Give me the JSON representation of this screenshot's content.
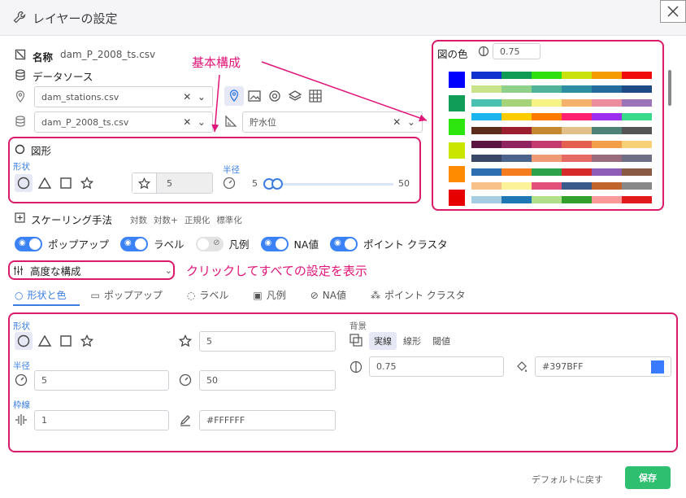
{
  "dialog": {
    "title": "レイヤーの設定"
  },
  "name": {
    "label": "名称",
    "value": "dam_P_2008_ts.csv"
  },
  "datasource": {
    "label": "データソース",
    "select1": "dam_stations.csv",
    "select2": "dam_P_2008_ts.csv",
    "select3": "貯水位"
  },
  "annotations": {
    "basic": "基本構成",
    "advanced": "クリックしてすべての設定を表示"
  },
  "shape": {
    "title": "図形",
    "shape_label": "形状",
    "radius_label": "半径",
    "size_value": "5",
    "slider_min": "5",
    "slider_max": "50"
  },
  "color": {
    "title": "図の色",
    "opacity": "0.75",
    "swatches": [
      "#0000ff",
      "#0f9d58",
      "#2ee60f",
      "#c8e600",
      "#ff8c00",
      "#e60000"
    ],
    "palettes": [
      [
        "#1033cf",
        "#119c55",
        "#2fe00f",
        "#c9e10c",
        "#f59c00",
        "#f00c0c"
      ],
      [
        "#c9e38a",
        "#8fd08b",
        "#4fb39a",
        "#2e8fa3",
        "#236c9c",
        "#1e4a85"
      ],
      [
        "#4ac0b0",
        "#a6d379",
        "#f7f286",
        "#f4b26a",
        "#ec8d9f",
        "#9b73b9"
      ],
      [
        "#1bb4ef",
        "#ffcc00",
        "#ff7a00",
        "#ff1f6e",
        "#9c2fef",
        "#39d98a"
      ],
      [
        "#5c2d1a",
        "#9c1f2f",
        "#c4882f",
        "#e3c08a",
        "#4f8277",
        "#555555"
      ],
      [
        "#5a1640",
        "#8f2460",
        "#c23a6e",
        "#e4614f",
        "#f39f4a",
        "#f7d077"
      ],
      [
        "#3a4766",
        "#4c648c",
        "#ee9a77",
        "#e56a66",
        "#9a6b7c",
        "#6e6e85"
      ],
      [
        "#2d6fb0",
        "#f57d1f",
        "#2ea24a",
        "#d52a2a",
        "#8e5db7",
        "#8a5a44"
      ],
      [
        "#f9c18a",
        "#fbf29a",
        "#e3507a",
        "#3a5a8c",
        "#c1642c",
        "#888888"
      ],
      [
        "#a5cee3",
        "#1f78b4",
        "#b2df8a",
        "#33a02c",
        "#fb9a99",
        "#e31a1c"
      ]
    ]
  },
  "scaling": {
    "label": "スケーリング手法",
    "options": [
      "対数",
      "対数+",
      "正規化",
      "標準化"
    ]
  },
  "toggles": [
    {
      "label": "ポップアップ",
      "on": true
    },
    {
      "label": "ラベル",
      "on": true
    },
    {
      "label": "凡例",
      "on": false
    },
    {
      "label": "NA値",
      "on": true
    },
    {
      "label": "ポイント クラスタ",
      "on": true
    }
  ],
  "advanced": {
    "label": "高度な構成"
  },
  "tabs": [
    "形状と色",
    "ポップアップ",
    "ラベル",
    "凡例",
    "NA値",
    "ポイント クラスタ"
  ],
  "detail": {
    "shape_label": "形状",
    "size_value": "5",
    "radius_label": "半径",
    "radius_min": "5",
    "radius_max": "50",
    "stroke_label": "枠線",
    "stroke_width": "1",
    "stroke_color": "#FFFFFF",
    "bg_label": "背景",
    "bg_options": [
      "実線",
      "線形",
      "閾値"
    ],
    "opacity": "0.75",
    "fill_color": "#397BFF",
    "fill_swatch": "#397bff"
  },
  "footer": {
    "reset": "デフォルトに戻す",
    "save": "保存"
  }
}
